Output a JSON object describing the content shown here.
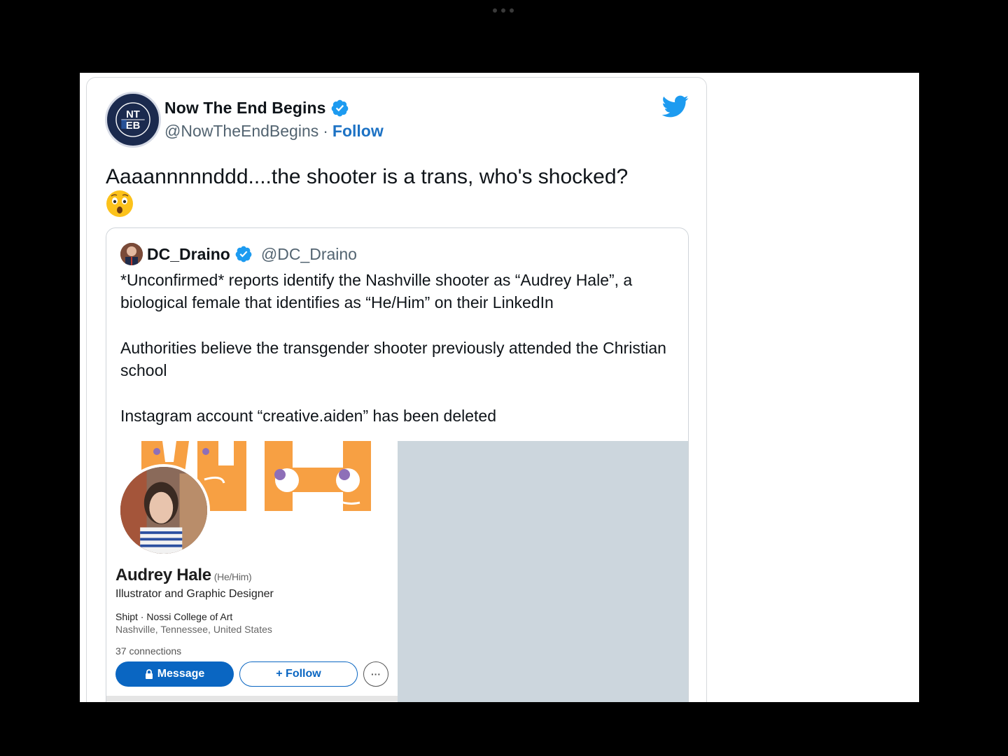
{
  "tweet": {
    "display_name": "Now The End Begins",
    "handle": "@NowTheEndBegins",
    "separator": "·",
    "follow_label": "Follow",
    "avatar_text_top": "NT",
    "avatar_text_bottom": "EB",
    "avatar_ring_text": "FRONT LINES OF THE END TIMES",
    "avatar_since": "SINCE 2009",
    "text": "Aaaannnnnddd....the shooter is a trans, who's shocked?",
    "emoji": "astonished-face"
  },
  "quoted_tweet": {
    "display_name": "DC_Draino",
    "handle": "@DC_Draino",
    "paragraphs": [
      "*Unconfirmed* reports identify the Nashville shooter as “Audrey Hale”, a biological female that identifies as “He/Him” on their LinkedIn",
      "Authorities believe the transgender shooter previously attended the Christian school",
      "Instagram account “creative.aiden” has been deleted"
    ]
  },
  "linkedin_card": {
    "name": "Audrey Hale",
    "pronouns": "(He/Him)",
    "title": "Illustrator and Graphic Designer",
    "company": "Shipt · Nossi College of Art",
    "location": "Nashville, Tennessee, United States",
    "connections": "37 connections",
    "message_label": "Message",
    "follow_label": "+ Follow",
    "more_label": "···"
  },
  "colors": {
    "twitter_blue": "#1d9bf0",
    "link_blue": "#1d72c4",
    "linkedin_blue": "#0a66c2",
    "banner_orange": "#f7a043",
    "banner_purple": "#8e6fb8",
    "placeholder_gray": "#ccd6dd"
  }
}
